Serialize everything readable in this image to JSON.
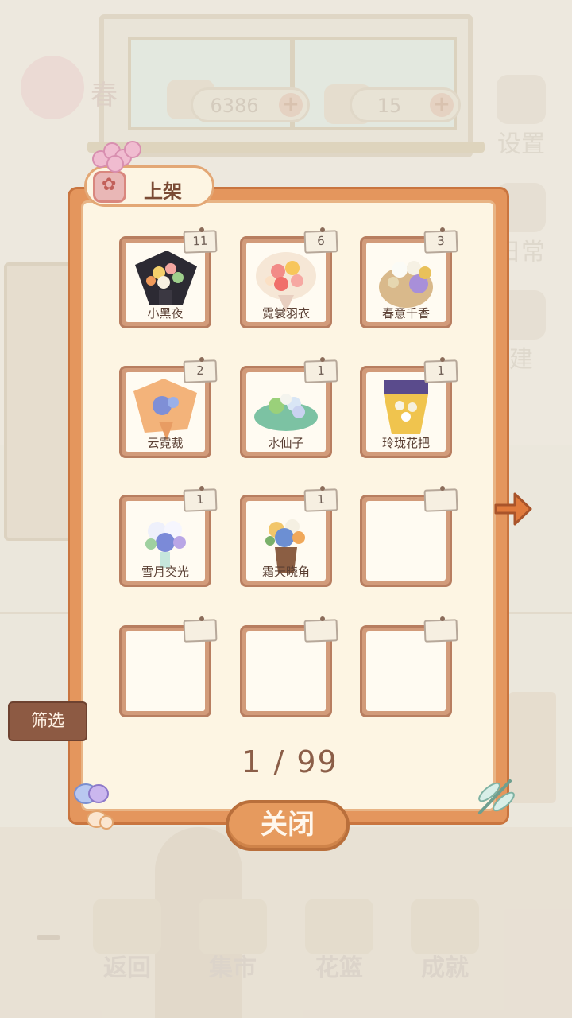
{
  "hud": {
    "season": "春",
    "fish_currency": "6386",
    "cheese_currency": "15",
    "plus": "+"
  },
  "side_menu": {
    "settings": "设置",
    "daily": "日常",
    "build": "建"
  },
  "panel": {
    "title": "上架",
    "slots": [
      {
        "name": "小黑夜",
        "count": "11"
      },
      {
        "name": "霓裳羽衣",
        "count": "6"
      },
      {
        "name": "春意千香",
        "count": "3"
      },
      {
        "name": "云霓裁",
        "count": "2"
      },
      {
        "name": "水仙子",
        "count": "1"
      },
      {
        "name": "玲珑花把",
        "count": "1"
      },
      {
        "name": "雪月交光",
        "count": "1"
      },
      {
        "name": "霜天晓角",
        "count": "1"
      },
      {
        "name": "",
        "count": ""
      },
      {
        "name": "",
        "count": ""
      },
      {
        "name": "",
        "count": ""
      },
      {
        "name": "",
        "count": ""
      }
    ],
    "pagination": "1 / 99",
    "filter_label": "筛选",
    "close_label": "关闭"
  },
  "bottom_nav": {
    "back": "返回",
    "market": "集市",
    "basket": "花篮",
    "achievements": "成就"
  }
}
